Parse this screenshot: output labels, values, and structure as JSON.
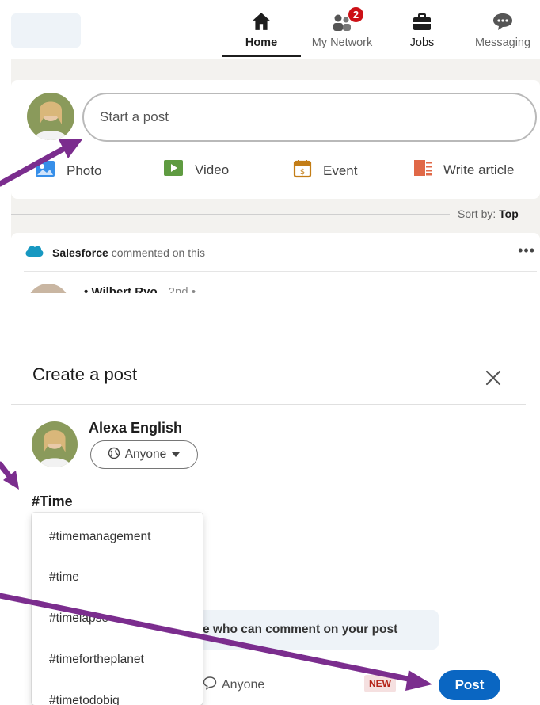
{
  "nav": {
    "home": {
      "label": "Home",
      "icon": "home-icon"
    },
    "network": {
      "label": "My Network",
      "icon": "people-icon",
      "badge": "2"
    },
    "jobs": {
      "label": "Jobs",
      "icon": "briefcase-icon"
    },
    "messaging": {
      "label": "Messaging",
      "icon": "chat-icon"
    }
  },
  "share_box": {
    "placeholder": "Start a post",
    "actions": [
      {
        "label": "Photo",
        "icon": "photo-icon",
        "color": "#378fe9"
      },
      {
        "label": "Video",
        "icon": "video-icon",
        "color": "#5f9b41"
      },
      {
        "label": "Event",
        "icon": "calendar-icon",
        "color": "#c37d16"
      },
      {
        "label": "Write article",
        "icon": "article-icon",
        "color": "#e06847"
      }
    ]
  },
  "sort": {
    "prefix": "Sort by:",
    "value": "Top"
  },
  "feed_card": {
    "company": "Salesforce",
    "activity": "commented on this",
    "more": "•••",
    "author_partial": "• Wilbert Ryo",
    "degree": "2nd •"
  },
  "modal": {
    "title": "Create a post",
    "author_name": "Alexa English",
    "audience": "Anyone",
    "compose_text": "#Time",
    "hashtag_suggestions": [
      "#timemanagement",
      "#time",
      "#timelapse",
      "#timefortheplanet",
      "#timetodobig"
    ],
    "comment_bar": "e who can comment on your post",
    "footer_audience": "Anyone",
    "new_badge": "NEW",
    "post_label": "Post"
  },
  "colors": {
    "accent": "#0a66c2",
    "annotation_arrow": "#7b2d8e",
    "notification": "#cc1016"
  }
}
